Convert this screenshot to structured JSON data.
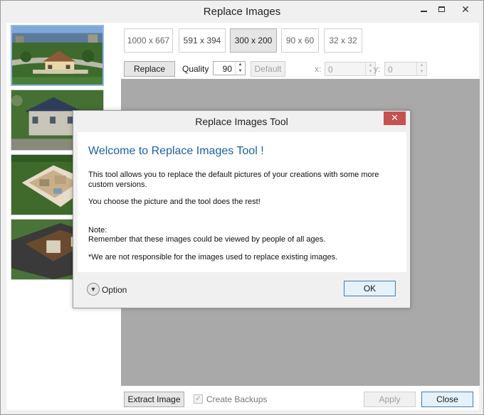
{
  "window": {
    "title": "Replace Images",
    "min_label": "",
    "close_glyph": "✕"
  },
  "thumbnails": [
    {
      "name": "house-aerial-1",
      "selected": true
    },
    {
      "name": "house-aerial-2",
      "selected": false
    },
    {
      "name": "house-floorplan-3",
      "selected": false
    },
    {
      "name": "house-roof-4",
      "selected": false
    }
  ],
  "sizes": [
    {
      "label": "1000 x 667",
      "active": false
    },
    {
      "label": "591 x 394",
      "active": false
    },
    {
      "label": "300 x 200",
      "active": true
    },
    {
      "label": "90 x 60",
      "active": false
    },
    {
      "label": "32 x 32",
      "active": false
    }
  ],
  "toolbar": {
    "replace_label": "Replace",
    "quality_label": "Quality",
    "quality_value": "90",
    "default_label": "Default",
    "x_label": "x:",
    "x_value": "0",
    "y_label": "y:",
    "y_value": "0"
  },
  "bottom": {
    "extract_label": "Extract Image",
    "create_backups_label": "Create Backups",
    "create_backups_checked": true,
    "apply_label": "Apply",
    "close_label": "Close"
  },
  "dialog": {
    "title": "Replace Images Tool",
    "close_glyph": "✕",
    "heading": "Welcome to Replace Images Tool !",
    "paragraph1": "This tool allows you to replace the default pictures of your creations with some more custom versions.",
    "paragraph2": "You choose the picture and the tool does the rest!",
    "note_title": "Note:",
    "note_text": "Remember that these images could be viewed by people of all ages.",
    "disclaimer": "*We are not responsible for the images used to replace existing images.",
    "option_label": "Option",
    "ok_label": "OK"
  },
  "colors": {
    "heading_blue": "#1e5fa8",
    "dialog_close_red": "#c75050",
    "canvas_grey": "#a9a9a9",
    "selected_border": "#8fb9e3"
  },
  "icons": {
    "option_chevron": "chevron-down-icon",
    "spin_up": "arrow-up-icon",
    "spin_down": "arrow-down-icon"
  }
}
